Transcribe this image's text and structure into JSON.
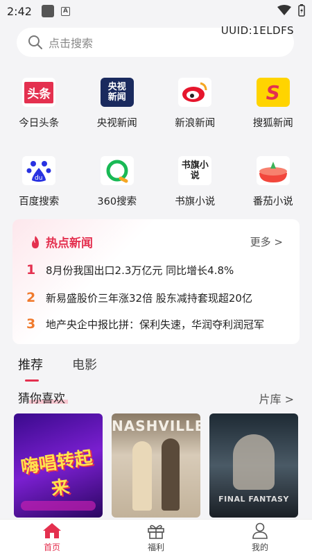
{
  "status": {
    "time": "2:42"
  },
  "search": {
    "placeholder": "点击搜索",
    "uuid": "UUID:1ELDFS"
  },
  "apps_row1": [
    {
      "label": "今日头条",
      "logo_text": "头条"
    },
    {
      "label": "央视新闻",
      "logo_text": "央视新闻"
    },
    {
      "label": "新浪新闻",
      "logo_text": ""
    },
    {
      "label": "搜狐新闻",
      "logo_text": "S"
    }
  ],
  "apps_row2": [
    {
      "label": "百度搜索",
      "logo_text": "du"
    },
    {
      "label": "360搜索",
      "logo_text": ""
    },
    {
      "label": "书旗小说",
      "logo_text": "书旗小说"
    },
    {
      "label": "番茄小说",
      "logo_text": ""
    }
  ],
  "hot_news": {
    "title": "热点新闻",
    "more": "更多 >",
    "items": [
      {
        "num": "1",
        "text": "8月份我国出口2.3万亿元 同比增长4.8%",
        "color": "#e4304f"
      },
      {
        "num": "2",
        "text": "新易盛股价三年涨32倍 股东减持套现超20亿",
        "color": "#f07a2d"
      },
      {
        "num": "3",
        "text": "地产央企中报比拼：保利失速，华润夺利润冠军",
        "color": "#f07a2d"
      }
    ]
  },
  "tabs": [
    {
      "label": "推荐"
    },
    {
      "label": "电影"
    }
  ],
  "section": {
    "title": "猜你喜欢",
    "more": "片库 >"
  },
  "posters": [
    {
      "title_text": "嗨唱转起来"
    },
    {
      "title_text": "NASHVILLE"
    },
    {
      "title_text": "FINAL FANTASY"
    }
  ],
  "nav": [
    {
      "label": "首页"
    },
    {
      "label": "福利"
    },
    {
      "label": "我的"
    }
  ],
  "colors": {
    "accent": "#e4304f"
  }
}
